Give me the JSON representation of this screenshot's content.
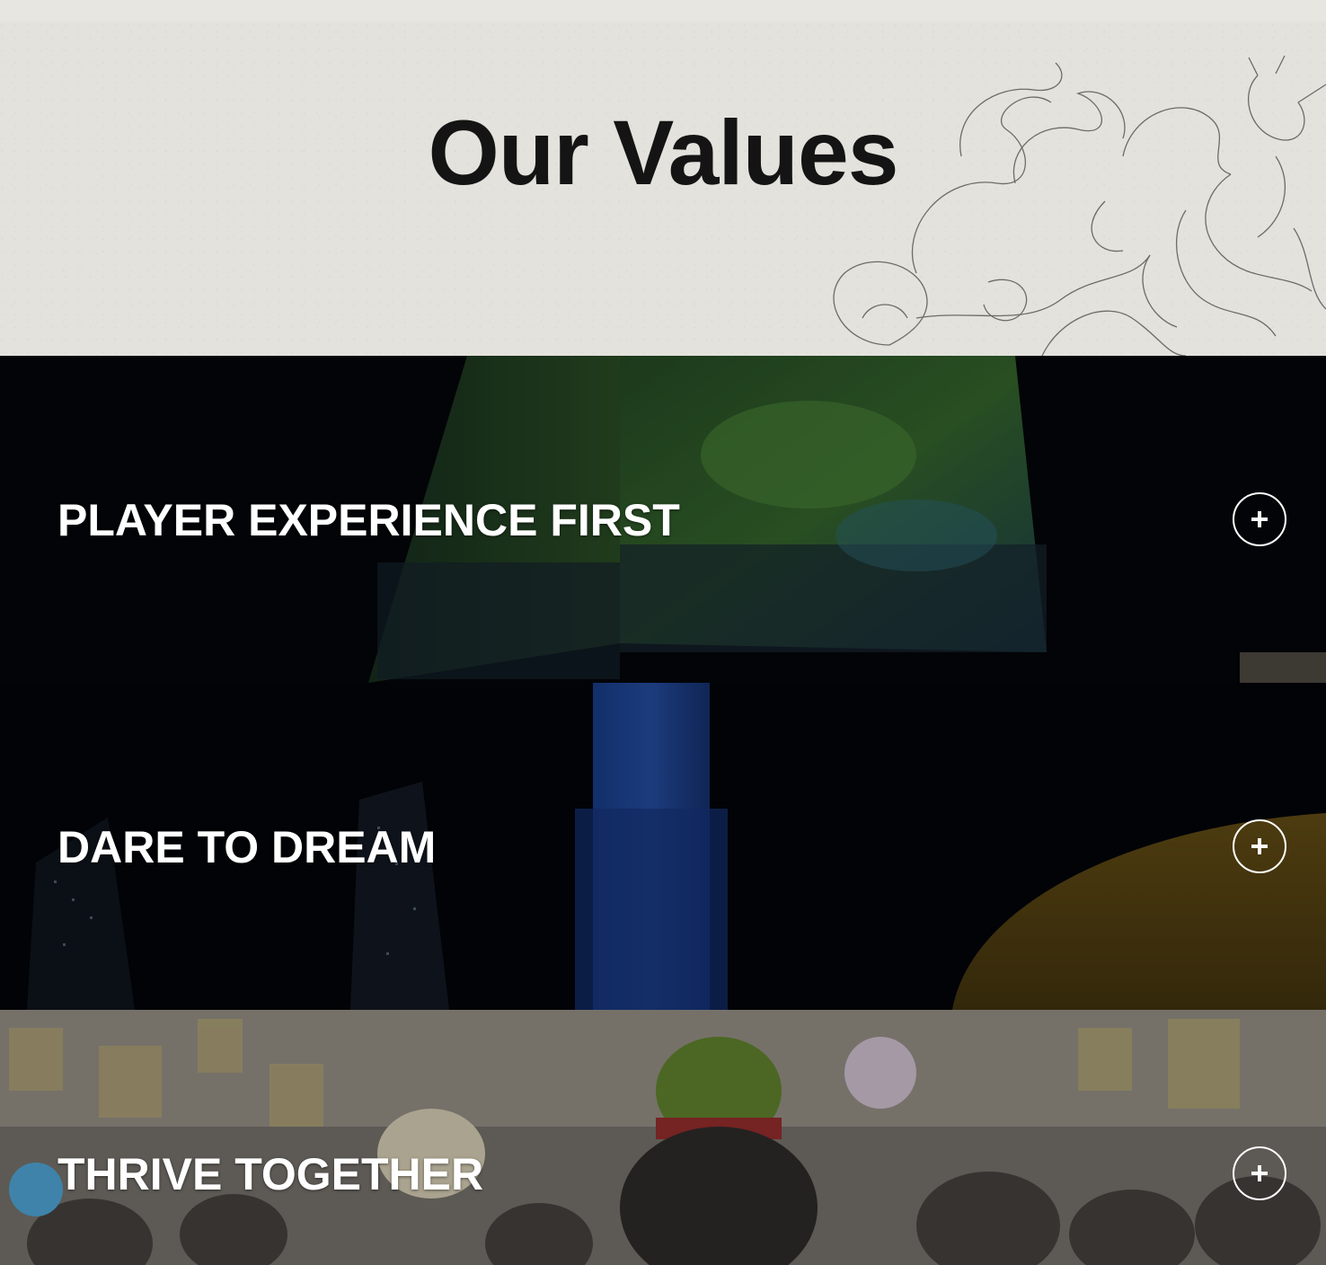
{
  "hero": {
    "title": "Our Values",
    "illustration": "fox-spirit-line-sketch"
  },
  "values": [
    {
      "title": "PLAYER EXPERIENCE FIRST",
      "background": "esports-arena-jumbotron",
      "icon": "plus-icon",
      "action": "expand"
    },
    {
      "title": "DARE TO DREAM",
      "background": "night-city-tower",
      "icon": "plus-icon",
      "action": "expand"
    },
    {
      "title": "THRIVE TOGETHER",
      "background": "office-celebration-crowd",
      "icon": "plus-icon",
      "action": "expand"
    }
  ],
  "colors": {
    "hero_bg": "#e4e2dd",
    "title_text": "#141414",
    "panel_text": "#ffffff"
  }
}
